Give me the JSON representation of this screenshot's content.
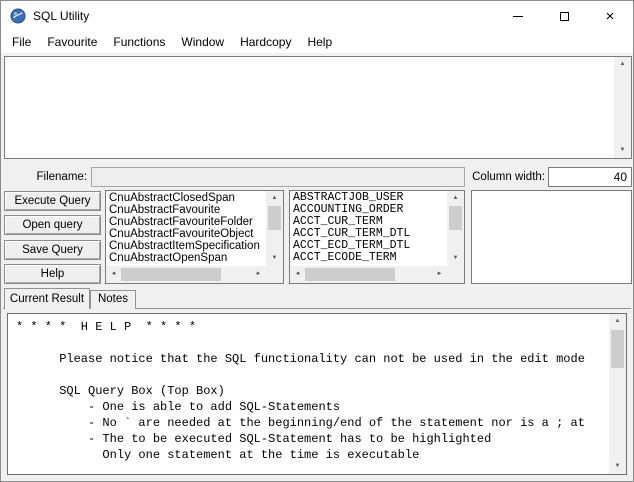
{
  "window": {
    "title": "SQL Utility"
  },
  "icons": {
    "close": "×",
    "scroll_up": "▲",
    "scroll_down": "▼",
    "scroll_left": "◄",
    "scroll_right": "►"
  },
  "menu": {
    "items": [
      {
        "label": "File"
      },
      {
        "label": "Favourite"
      },
      {
        "label": "Functions"
      },
      {
        "label": "Window"
      },
      {
        "label": "Hardcopy"
      },
      {
        "label": "Help"
      }
    ]
  },
  "query_box": {
    "value": ""
  },
  "filename": {
    "label": "Filename:",
    "value": ""
  },
  "column_width": {
    "label": "Column width:",
    "value": "40"
  },
  "action_buttons": [
    {
      "label": "Execute Query"
    },
    {
      "label": "Open query"
    },
    {
      "label": "Save Query"
    },
    {
      "label": "Help"
    }
  ],
  "object_list": {
    "items": [
      "CnuAbstractClosedSpan",
      "CnuAbstractFavourite",
      "CnuAbstractFavouriteFolder",
      "CnuAbstractFavouriteObject",
      "CnuAbstractItemSpecification",
      "CnuAbstractOpenSpan"
    ]
  },
  "table_list": {
    "items": [
      "ABSTRACTJOB_USER",
      "ACCOUNTING_ORDER",
      "ACCT_CUR_TERM",
      "ACCT_CUR_TERM_DTL",
      "ACCT_ECD_TERM_DTL",
      "ACCT_ECODE_TERM"
    ]
  },
  "tabs": [
    {
      "label": "Current Result",
      "active": true
    },
    {
      "label": "Notes",
      "active": false
    }
  ],
  "result": {
    "lines": [
      "* * * *  H E L P  * * * *",
      "",
      "      Please notice that the SQL functionality can not be used in the edit mode",
      "",
      "      SQL Query Box (Top Box)",
      "          - One is able to add SQL-Statements",
      "          - No ` are needed at the beginning/end of the statement nor is a ; at",
      "          - The to be executed SQL-Statement has to be highlighted",
      "            Only one statement at the time is executable"
    ]
  },
  "colors": {
    "window_bg": "#f0f0f0",
    "titlebar_bg": "#ffffff",
    "content_bg": "#ffffff",
    "border": "#7a7a7a",
    "scrollbar_track": "#f0f0f0",
    "scrollbar_thumb": "#cdcdcd",
    "app_icon_blue": "#3b6fb6"
  }
}
